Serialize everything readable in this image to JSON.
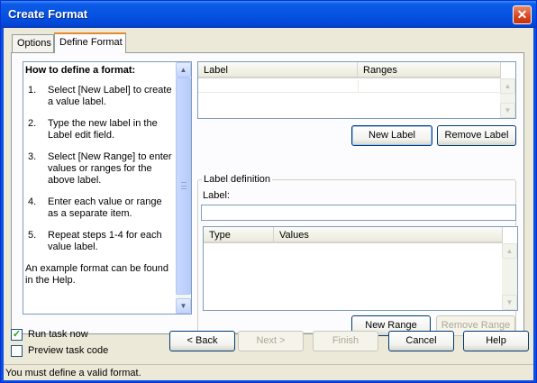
{
  "window": {
    "title": "Create Format",
    "close_icon": "✕"
  },
  "tabs": [
    {
      "label": "Options",
      "active": false
    },
    {
      "label": "Define Format",
      "active": true
    }
  ],
  "help": {
    "heading": "How to define a format:",
    "steps": [
      {
        "num": "1.",
        "text": "Select [New Label] to create a value label."
      },
      {
        "num": "2.",
        "text": "Type the new label in the Label edit field."
      },
      {
        "num": "3.",
        "text": "Select [New Range] to enter values or ranges for the above label."
      },
      {
        "num": "4.",
        "text": "Enter each value or range as a separate item."
      },
      {
        "num": "5.",
        "text": "Repeat steps 1-4 for each value label."
      }
    ],
    "footer": "An example format can be found in the Help."
  },
  "labels_list": {
    "columns": [
      "Label",
      "Ranges"
    ]
  },
  "label_buttons": {
    "new_label": "New Label",
    "remove_label": "Remove Label"
  },
  "label_definition": {
    "legend": "Label definition",
    "label_field_label": "Label:",
    "label_value": "",
    "columns": [
      "Type",
      "Values"
    ],
    "new_range": "New Range",
    "remove_range": "Remove Range"
  },
  "options": {
    "run_task_now": {
      "label": "Run task now",
      "checked": true
    },
    "preview_task_code": {
      "label": "Preview task code",
      "checked": false
    }
  },
  "nav_buttons": {
    "back": "< Back",
    "next": "Next >",
    "finish": "Finish",
    "cancel": "Cancel",
    "help": "Help"
  },
  "status": "You must define a valid format.",
  "icons": {
    "scroll_up": "▲",
    "scroll_down": "▼",
    "check": "✓"
  }
}
